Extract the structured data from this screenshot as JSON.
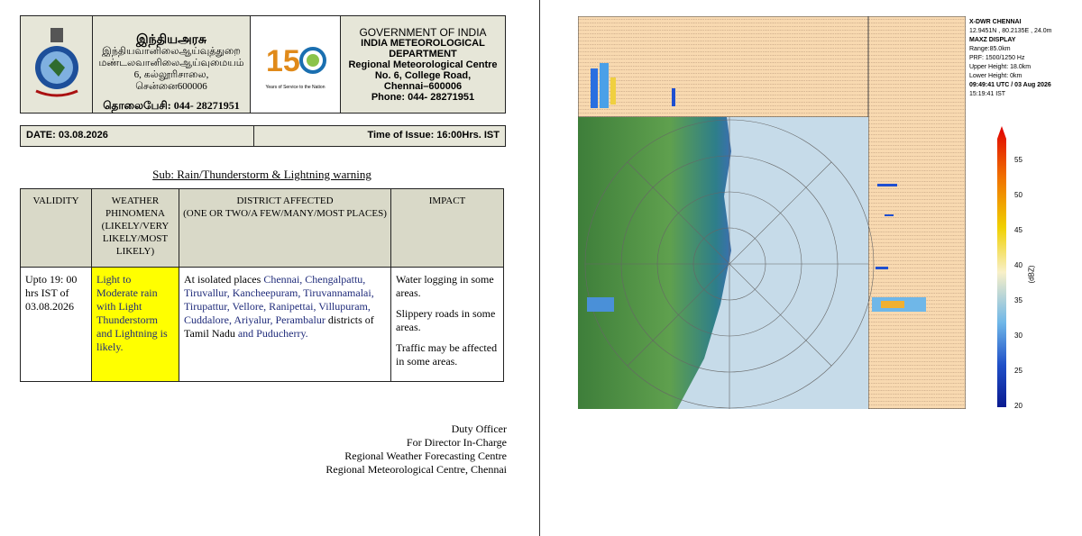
{
  "header": {
    "tamil_line1": "இந்தியஅரசு",
    "tamil_line2": "இந்தியவானிலைஆய்வுத்துறை",
    "tamil_line3": "மண்டலவானிலைஆய்வுமையம்",
    "tamil_line4": "6, கல்லூரிசாலை,",
    "tamil_line5": "சென்னை600006",
    "tamil_phone": "தொலைபேசி:  044- 28271951",
    "logo_text": "150",
    "logo_caption": "Years of Service to the Nation",
    "eng_line1": "GOVERNMENT OF INDIA",
    "eng_line2": "INDIA METEOROLOGICAL DEPARTMENT",
    "eng_line3": "Regional Meteorological Centre",
    "eng_line4": "No. 6, College Road,",
    "eng_line5": "Chennai–600006",
    "eng_phone": "Phone:  044- 28271951"
  },
  "date_label": "DATE: 03.08.2026",
  "issue_label": "Time of Issue: 16:00Hrs. IST",
  "subject": "Sub: Rain/Thunderstorm & Lightning warning",
  "table": {
    "headers": {
      "validity": "VALIDITY",
      "weather": "WEATHER PHINOMENA (LIKELY/VERY LIKELY/MOST LIKELY)",
      "district": "DISTRICT AFFECTED",
      "district_sub": "(ONE OR TWO/A FEW/MANY/MOST PLACES)",
      "impact": "IMPACT"
    },
    "row": {
      "validity": "Upto 19: 00 hrs IST of 03.08.2026",
      "weather": "Light to Moderate rain with Light Thunderstorm and Lightning is likely.",
      "district_prefix": "At isolated places ",
      "district_list": "Chennai, Chengalpattu, Tiruvallur, Kancheepuram, Tiruvannamalai, Tirupattur, Vellore, Ranipettai, Villupuram, Cuddalore, Ariyalur, Perambalur",
      "district_mid": " districts of Tamil Nadu ",
      "district_and": "and",
      "district_end": " Puducherry.",
      "impact1": "Water logging in some areas.",
      "impact2": "Slippery roads in some areas.",
      "impact3": "Traffic may be affected in some areas."
    }
  },
  "signature": {
    "line1": "Duty Officer",
    "line2": "For Director In-Charge",
    "line3": "Regional Weather Forecasting Centre",
    "line4": "Regional Meteorological Centre, Chennai"
  },
  "radar": {
    "title": "X-DWR CHENNAI",
    "coords": "12.9451N , 80.2135E , 24.0m",
    "display": "MAXZ DISPLAY",
    "range": "Range:85.0km",
    "prf": "PRF: 1500/1250 Hz",
    "upper": "Upper Height: 18.0km",
    "lower": "Lower Height: 0km",
    "utc": "09:49:41 UTC / 03 Aug 2026",
    "ist": "15:19:41  IST",
    "unit": "(dBZ)",
    "scale": [
      "55",
      "50",
      "45",
      "40",
      "35",
      "30",
      "25",
      "20"
    ]
  }
}
